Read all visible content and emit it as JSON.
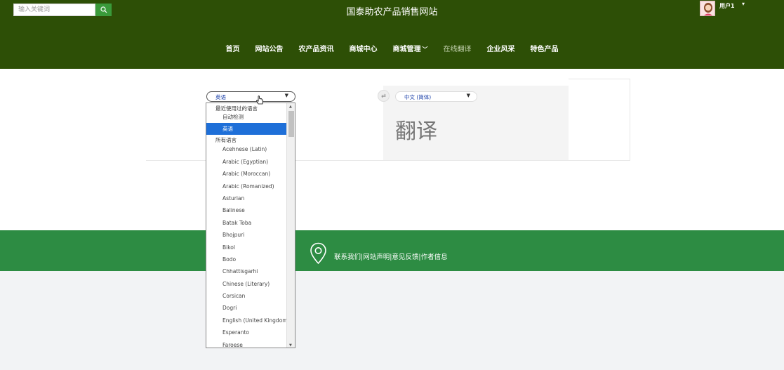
{
  "header": {
    "search_placeholder": "输入关键词",
    "site_title": "国泰助农产品销售网站",
    "user_name": "用户1",
    "nav": [
      {
        "label": "首页",
        "active": false
      },
      {
        "label": "网站公告",
        "active": false
      },
      {
        "label": "农产品资讯",
        "active": false
      },
      {
        "label": "商城中心",
        "active": false
      },
      {
        "label": "商城管理",
        "active": false,
        "has_dropdown": true
      },
      {
        "label": "在线翻译",
        "active": true
      },
      {
        "label": "企业风采",
        "active": false
      },
      {
        "label": "特色产品",
        "active": false
      }
    ]
  },
  "translator": {
    "source_language": "英语",
    "target_language": "中文 (简体)",
    "translation_text": "翻译",
    "dropdown": {
      "recent_group": "最近使用过的语言",
      "recent_items": [
        "自动检测",
        "英语"
      ],
      "selected": "英语",
      "all_group": "所有语言",
      "all_items": [
        "Acehnese (Latin)",
        "Arabic (Egyptian)",
        "Arabic (Moroccan)",
        "Arabic (Romanized)",
        "Asturian",
        "Balinese",
        "Batak Toba",
        "Bhojpuri",
        "Bikol",
        "Bodo",
        "Chhattisgarhi",
        "Chinese (Literary)",
        "Corsican",
        "Dogri",
        "English (United Kingdom)",
        "Esperanto",
        "Faroese"
      ]
    }
  },
  "footer": {
    "links": "联系我们|网站声明|意见反馈|作者信息"
  },
  "colors": {
    "header_bg": "#2d4f06",
    "footer_bg": "#2d8c43",
    "selected_option": "#1e6fd8"
  }
}
